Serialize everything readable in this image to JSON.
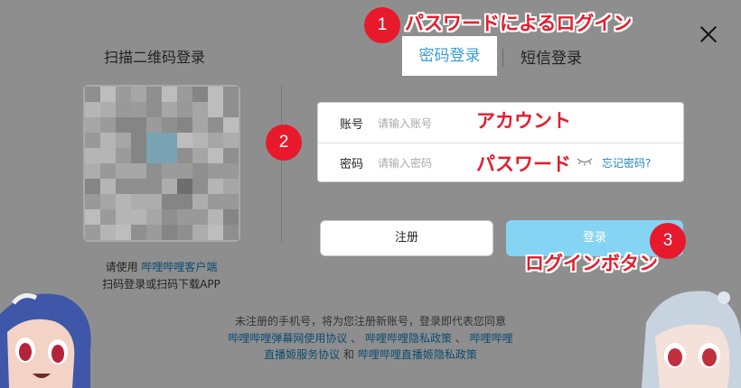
{
  "qr_section": {
    "title": "扫描二维码登录",
    "hint_prefix": "请使用 ",
    "hint_link": "哔哩哔哩客户端",
    "hint_line2": "扫码登录或扫码下载APP"
  },
  "tabs": [
    {
      "label": "密码登录",
      "active": true
    },
    {
      "label": "短信登录",
      "active": false
    }
  ],
  "form": {
    "account_label": "账号",
    "account_placeholder": "请输入账号",
    "password_label": "密码",
    "password_placeholder": "请输入密码",
    "forgot_label": "忘记密码?"
  },
  "buttons": {
    "register": "注册",
    "login": "登录"
  },
  "agreement": {
    "line1": "未注册的手机号，将为您注册新账号，登录即代表您同意",
    "link1": "哔哩哔哩弹幕网使用协议",
    "sep1": " 、 ",
    "link2": "哔哩哔哩隐私政策",
    "sep2": " 、 ",
    "link3a": "哔哩哔哩",
    "link3b": "直播姬服务协议",
    "and": " 和 ",
    "link4": "哔哩哔哩直播姬隐私政策"
  },
  "annotations": {
    "badge1": "1",
    "badge2": "2",
    "badge3": "3",
    "label_password_login": "パスワードによるログイン",
    "label_account": "アカウント",
    "label_password": "パスワード",
    "label_login_button": "ログインボタン"
  },
  "colors": {
    "overlay": "#8e8e8e",
    "accent_blue": "#3a9bd1",
    "login_button": "#86d4f3",
    "annotation_red": "#e51c2e"
  },
  "icons": [
    "close-icon",
    "eye-closed-icon"
  ]
}
